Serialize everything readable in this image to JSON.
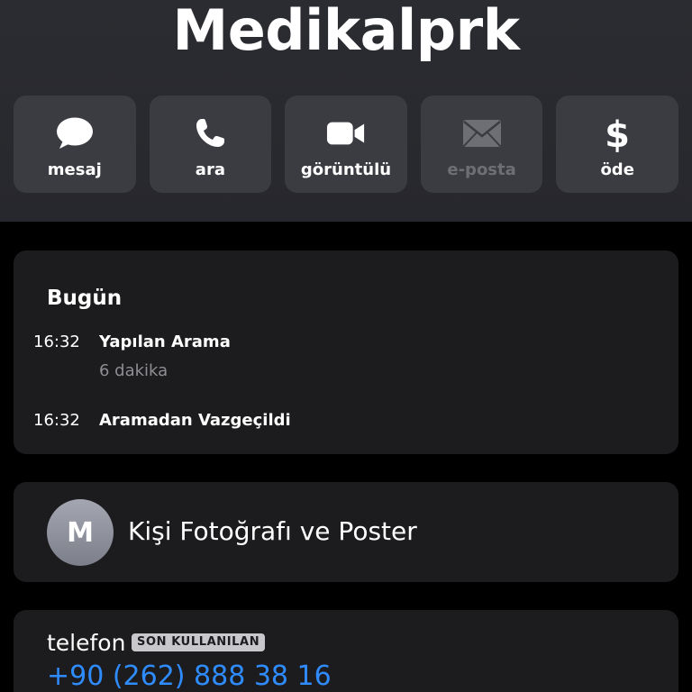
{
  "contact": {
    "name": "Medikalprk"
  },
  "actions": [
    {
      "id": "message",
      "label": "mesaj",
      "icon": "message-bubble-icon",
      "enabled": true
    },
    {
      "id": "call",
      "label": "ara",
      "icon": "phone-icon",
      "enabled": true
    },
    {
      "id": "video",
      "label": "görüntülü",
      "icon": "video-camera-icon",
      "enabled": true
    },
    {
      "id": "email",
      "label": "e-posta",
      "icon": "envelope-icon",
      "enabled": false
    },
    {
      "id": "pay",
      "label": "öde",
      "icon": "dollar-icon",
      "enabled": true
    }
  ],
  "recents": {
    "day": "Bugün",
    "entries": [
      {
        "time": "16:32",
        "title": "Yapılan Arama",
        "detail": "6 dakika"
      },
      {
        "time": "16:32",
        "title": "Aramadan Vazgeçildi",
        "detail": ""
      }
    ]
  },
  "poster": {
    "avatar_initial": "M",
    "label": "Kişi Fotoğrafı ve Poster"
  },
  "phone": {
    "label": "telefon",
    "badge": "SON KULLANILAN",
    "number": "+90 (262) 888 38 16"
  },
  "colors": {
    "accent_blue": "#2f8cff",
    "card_bg": "#1c1c1e",
    "header_bg": "#2b2c31",
    "button_bg": "#3b3c42",
    "secondary_text": "#8e8e93"
  }
}
